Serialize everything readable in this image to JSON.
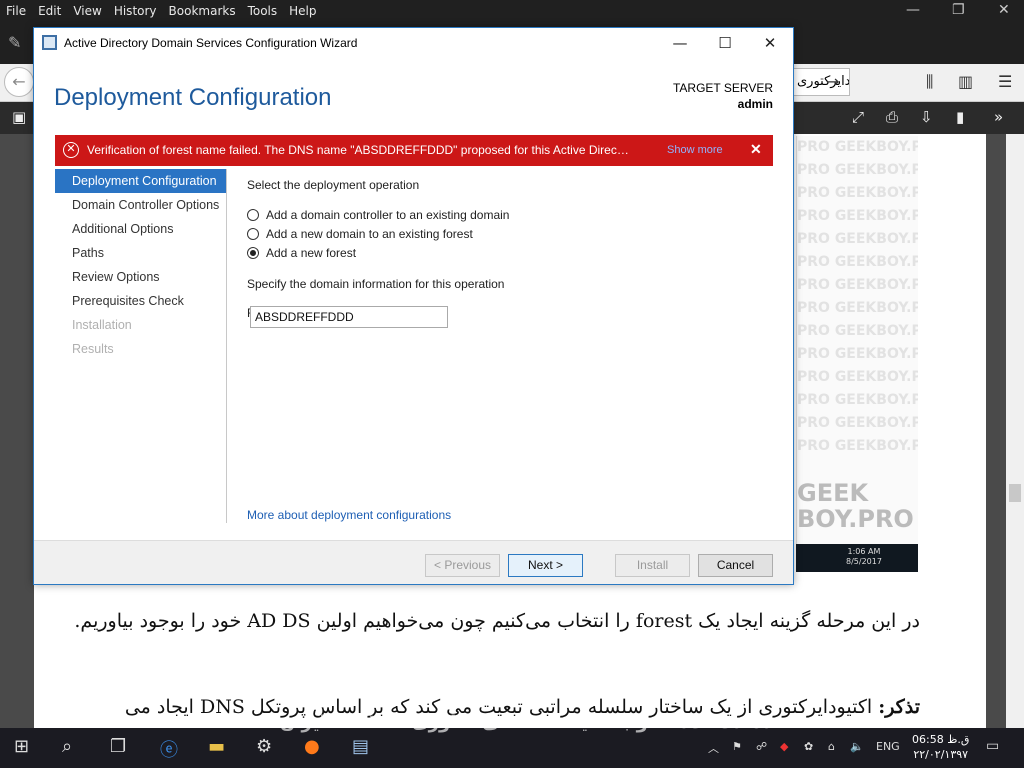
{
  "browser": {
    "menu": [
      "File",
      "Edit",
      "View",
      "History",
      "Bookmarks",
      "Tools",
      "Help"
    ],
    "url_fragment": "دایرکتوری",
    "watermark_line": "PRO GEEKBOY.PR",
    "watermark_logo_1": "GEEK",
    "watermark_logo_2": "BOY.PRO",
    "thumb_time": "1:06 AM",
    "thumb_date": "8/5/2017"
  },
  "article": {
    "para1": "در این مرحله گزینه ایجاد یک forest را انتخاب می‌کنیم چون می‌خواهیم اولین AD DS خود را بوجود بیاوریم.",
    "note_label": "تذکر:",
    "note_text": " اکتیودایرکتوری از یک ساختار سلسله مراتبی تبعیت می کند که بر اساس پروتکل DNS ایجاد می",
    "site_watermark": "Tosinso.com - وب سایت تخصصی فناوری اطلاعات ایران"
  },
  "dialog": {
    "window_title": "Active Directory Domain Services Configuration Wizard",
    "heading": "Deployment Configuration",
    "target_label": "TARGET SERVER",
    "target_value": "admin",
    "error_message": "Verification of forest name failed. The DNS name \"ABSDDREFFDDD\" proposed for this Active Directory dom...",
    "show_more": "Show more",
    "nav": [
      {
        "label": "Deployment Configuration",
        "state": "selected"
      },
      {
        "label": "Domain Controller Options",
        "state": "normal"
      },
      {
        "label": "Additional Options",
        "state": "normal"
      },
      {
        "label": "Paths",
        "state": "normal"
      },
      {
        "label": "Review Options",
        "state": "normal"
      },
      {
        "label": "Prerequisites Check",
        "state": "normal"
      },
      {
        "label": "Installation",
        "state": "disabled"
      },
      {
        "label": "Results",
        "state": "disabled"
      }
    ],
    "select_label": "Select the deployment operation",
    "options": [
      {
        "label": "Add a domain controller to an existing domain",
        "checked": false
      },
      {
        "label": "Add a new domain to an existing forest",
        "checked": false
      },
      {
        "label": "Add a new forest",
        "checked": true
      }
    ],
    "specify_label": "Specify the domain information for this operation",
    "root_domain_label": "Root domain name:",
    "root_domain_value": "ABSDDREFFDDD",
    "more_link": "More about deployment configurations",
    "buttons": {
      "previous": "< Previous",
      "next": "Next >",
      "install": "Install",
      "cancel": "Cancel"
    }
  },
  "taskbar": {
    "lang": "ENG",
    "time": "06:58 ق.ظ",
    "date": "۲۲/۰۲/۱۳۹۷"
  },
  "colors": {
    "accent": "#2a74c4",
    "error": "#cc1717",
    "heading": "#1e5a9c"
  }
}
